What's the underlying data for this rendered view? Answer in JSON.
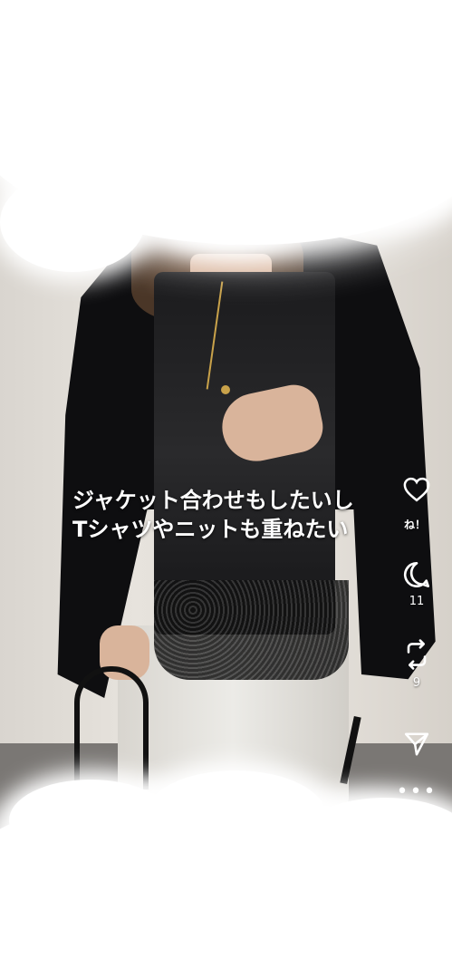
{
  "caption": {
    "line1": "ジャケット合わせもしたいし",
    "line2": "Tシャツやニットも重ねたい"
  },
  "actions": {
    "like": {
      "icon": "heart-icon",
      "label": "ね！"
    },
    "comment": {
      "icon": "comment-icon",
      "count": "11"
    },
    "repost": {
      "icon": "repost-icon",
      "count": "9"
    },
    "share": {
      "icon": "share-icon"
    },
    "more": {
      "icon": "more-icon",
      "label": "•••"
    }
  },
  "colors": {
    "icon": "#ffffff",
    "cloud": "#ffffff",
    "jacket": "#0e0e10"
  }
}
